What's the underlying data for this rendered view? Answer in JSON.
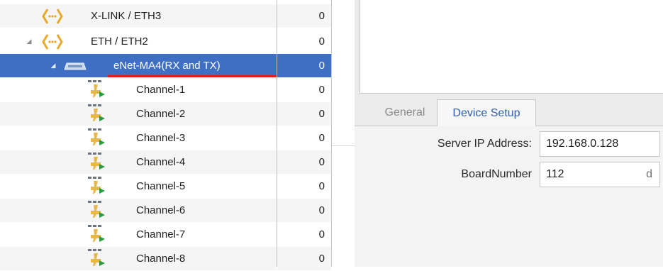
{
  "tree": {
    "rows": [
      {
        "label": "X-LINK / ETH3",
        "count": "0",
        "icon": "link-icon",
        "expander": ""
      },
      {
        "label": "ETH / ETH2",
        "count": "0",
        "icon": "link-icon",
        "expander": "◢"
      },
      {
        "label": "eNet-MA4(RX and TX)",
        "count": "0",
        "icon": "network-device-icon",
        "expander": "◢"
      },
      {
        "label": "Channel-1",
        "count": "0",
        "icon": "channel-icon",
        "expander": ""
      },
      {
        "label": "Channel-2",
        "count": "0",
        "icon": "channel-icon",
        "expander": ""
      },
      {
        "label": "Channel-3",
        "count": "0",
        "icon": "channel-icon",
        "expander": ""
      },
      {
        "label": "Channel-4",
        "count": "0",
        "icon": "channel-icon",
        "expander": ""
      },
      {
        "label": "Channel-5",
        "count": "0",
        "icon": "channel-icon",
        "expander": ""
      },
      {
        "label": "Channel-6",
        "count": "0",
        "icon": "channel-icon",
        "expander": ""
      },
      {
        "label": "Channel-7",
        "count": "0",
        "icon": "channel-icon",
        "expander": ""
      },
      {
        "label": "Channel-8",
        "count": "0",
        "icon": "channel-icon",
        "expander": ""
      }
    ],
    "selected_label": "eNet-MA4(RX and TX)"
  },
  "tabs": {
    "general": "General",
    "device_setup": "Device Setup",
    "active": "Device Setup"
  },
  "properties": {
    "server_ip_label": "Server IP Address:",
    "server_ip_value": "192.168.0.128",
    "board_number_label": "BoardNumber",
    "board_number_value": "112",
    "board_number_unit": "d"
  },
  "colors": {
    "selection": "#3f6fc5",
    "selection_underline": "#e01e1e",
    "active_tab_text": "#2e5fb0",
    "link_icon": "#e8a92a"
  }
}
